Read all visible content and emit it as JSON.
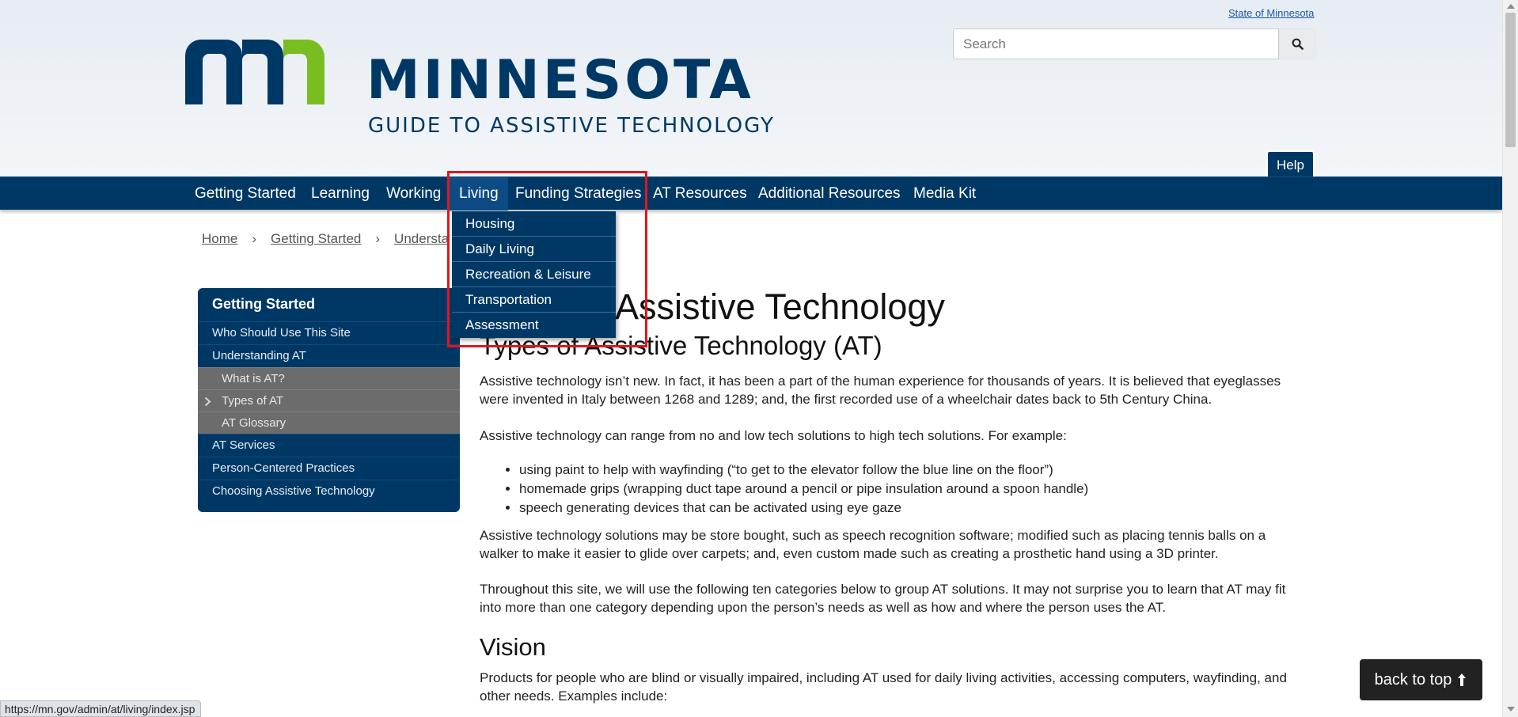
{
  "header": {
    "state_link": "State of Minnesota",
    "search_placeholder": "Search",
    "logo_title": "MINNESOTA",
    "logo_subtitle": "GUIDE TO ASSISTIVE TECHNOLOGY",
    "help_label": "Help",
    "colors": {
      "brand_blue": "#003865",
      "brand_green": "#78be21"
    }
  },
  "nav": {
    "items": [
      {
        "label": "Getting Started"
      },
      {
        "label": "Learning"
      },
      {
        "label": "Working"
      },
      {
        "label": "Living",
        "active": true
      },
      {
        "label": "Funding Strategies"
      },
      {
        "label": "AT Resources"
      },
      {
        "label": "Additional Resources"
      },
      {
        "label": "Media Kit"
      }
    ],
    "living_dropdown": [
      {
        "label": "Housing"
      },
      {
        "label": "Daily Living"
      },
      {
        "label": "Recreation & Leisure"
      },
      {
        "label": "Transportation"
      },
      {
        "label": "Assessment"
      }
    ]
  },
  "breadcrumb": {
    "items": [
      {
        "label": "Home"
      },
      {
        "label": "Getting Started"
      },
      {
        "label": "Understa"
      }
    ],
    "separator": "›"
  },
  "sidebar": {
    "title": "Getting Started",
    "items": [
      {
        "label": "Who Should Use This Site"
      },
      {
        "label": "Understanding AT"
      },
      {
        "label": "What is AT?"
      },
      {
        "label": "Types of AT"
      },
      {
        "label": "AT Glossary"
      },
      {
        "label": "AT Services"
      },
      {
        "label": "Person-Centered Practices"
      },
      {
        "label": "Choosing Assistive Technology"
      }
    ]
  },
  "main": {
    "heading_partial": "Assistive Technology",
    "subheading": "Types of Assistive Technology (AT)",
    "para1": "Assistive technology isn’t new. In fact, it has been a part of the human experience for thousands of years. It is believed that eyeglasses were invented in Italy between 1268 and 1289; and, the first recorded use of a wheelchair dates back to 5th Century China.",
    "para2": "Assistive technology can range from no and low tech solutions to high tech solutions. For example:",
    "bullets": [
      "using paint to help with wayfinding (“to get to the elevator follow the blue line on the floor”)",
      "homemade grips (wrapping duct tape around a pencil or pipe insulation around a spoon handle)",
      "speech generating devices that can be activated using eye gaze"
    ],
    "para3": "Assistive technology solutions may be store bought, such as speech recognition software; modified such as placing tennis balls on a walker to make it easier to glide over carpets; and, even custom made such as creating a prosthetic hand using a 3D printer.",
    "para4": "Throughout this site, we will use the following ten categories below to group AT solutions. It may not surprise you to learn that AT may fit into more than one category depending upon the person’s needs as well as how and where the person uses the AT.",
    "section_title": "Vision",
    "para5": "Products for people who are blind or visually impaired, including AT used for daily living activities, accessing computers, wayfinding, and other needs. Examples include:"
  },
  "back_to_top": "back to top",
  "status_url": "https://mn.gov/admin/at/living/index.jsp"
}
